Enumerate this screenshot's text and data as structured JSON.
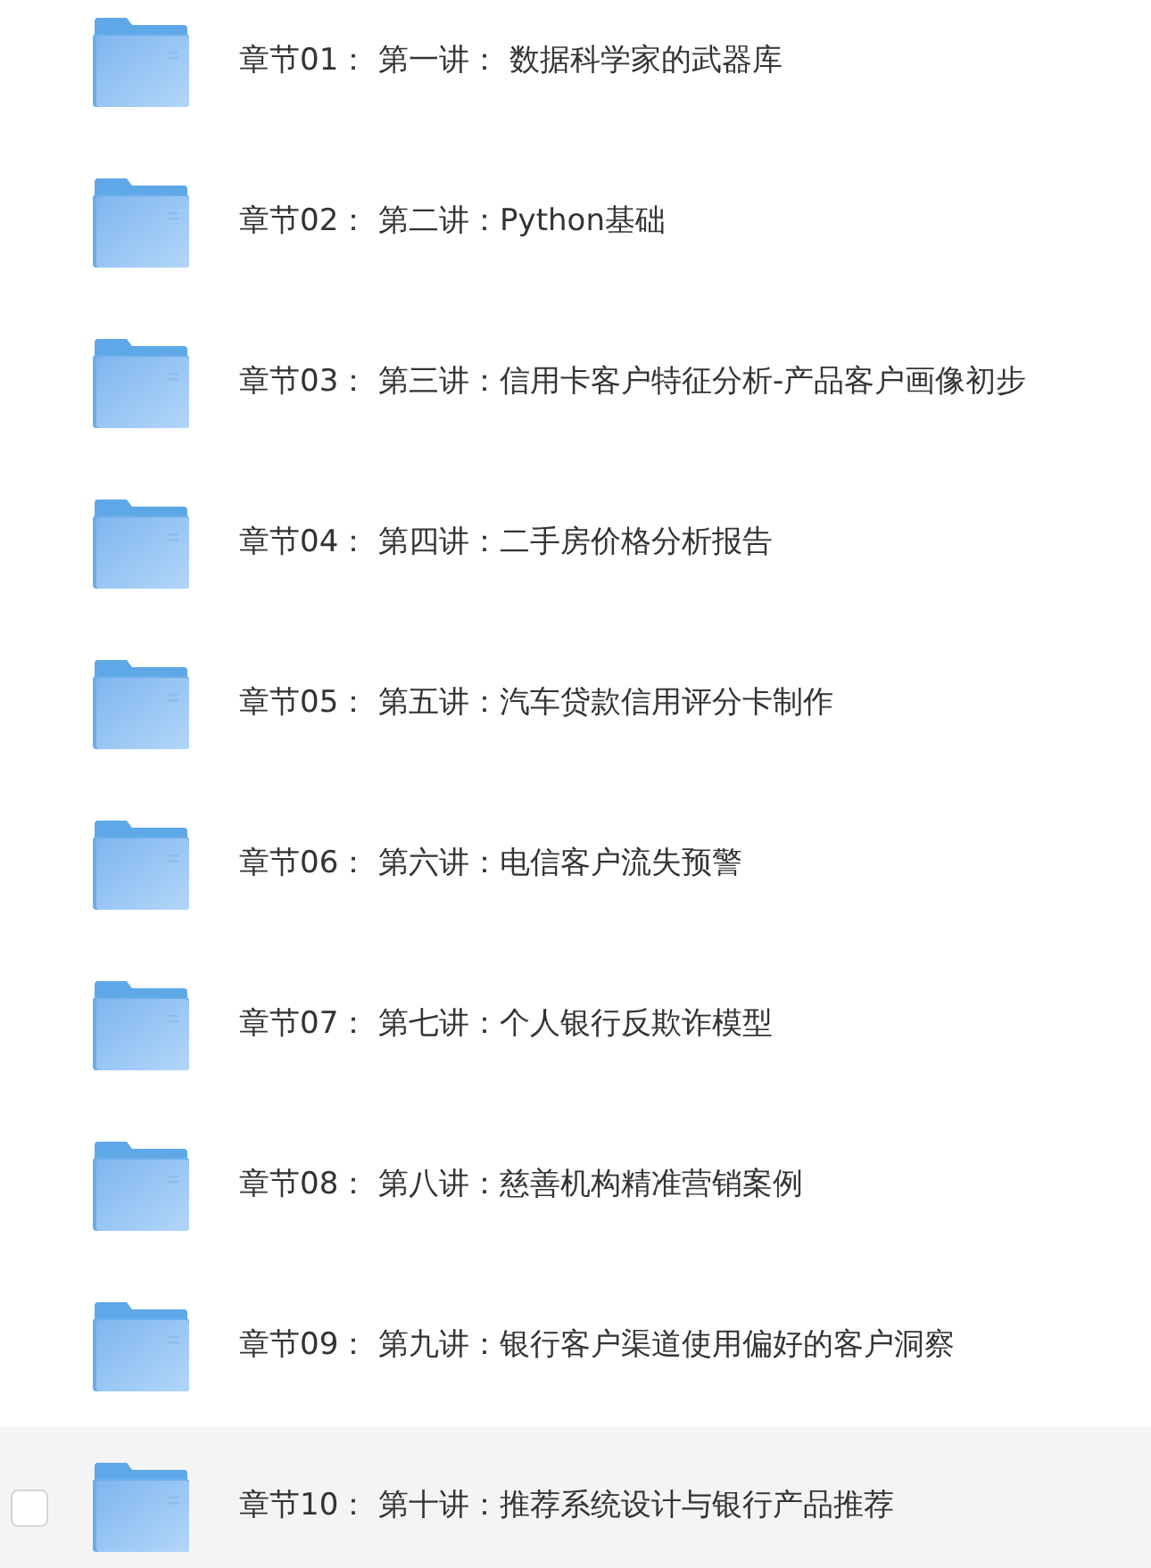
{
  "folders": [
    {
      "name": "章节01： 第一讲： 数据科学家的武器库",
      "highlighted": false,
      "checked": false
    },
    {
      "name": "章节02： 第二讲：Python基础",
      "highlighted": false,
      "checked": false
    },
    {
      "name": "章节03： 第三讲：信用卡客户特征分析-产品客户画像初步",
      "highlighted": false,
      "checked": false
    },
    {
      "name": "章节04： 第四讲：二手房价格分析报告",
      "highlighted": false,
      "checked": false
    },
    {
      "name": "章节05： 第五讲：汽车贷款信用评分卡制作",
      "highlighted": false,
      "checked": false
    },
    {
      "name": "章节06： 第六讲：电信客户流失预警",
      "highlighted": false,
      "checked": false
    },
    {
      "name": "章节07： 第七讲：个人银行反欺诈模型",
      "highlighted": false,
      "checked": false
    },
    {
      "name": "章节08： 第八讲：慈善机构精准营销案例",
      "highlighted": false,
      "checked": false
    },
    {
      "name": "章节09： 第九讲：银行客户渠道使用偏好的客户洞察",
      "highlighted": false,
      "checked": false
    },
    {
      "name": "章节10： 第十讲：推荐系统设计与银行产品推荐",
      "highlighted": true,
      "checked": false
    }
  ]
}
